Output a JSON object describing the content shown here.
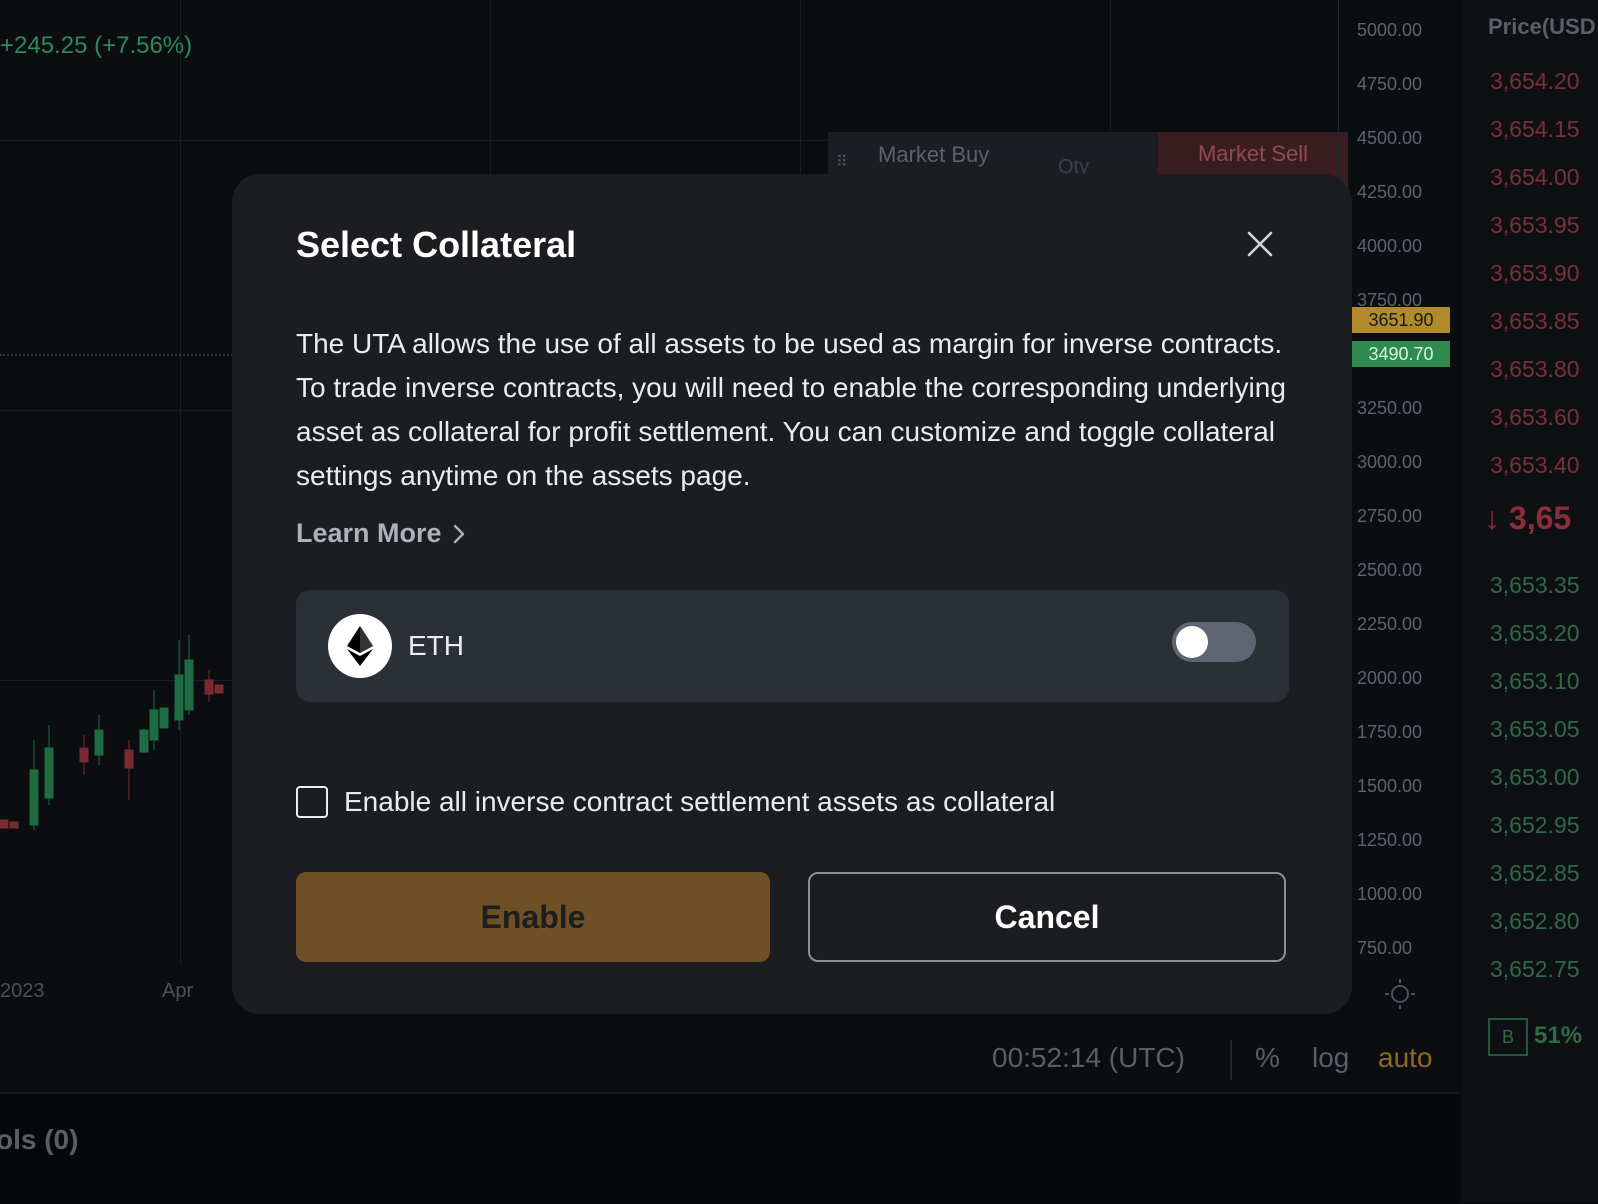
{
  "background": {
    "change_text": "+245.25 (+7.56%)",
    "price_axis": [
      "5000.00",
      "4750.00",
      "4500.00",
      "4250.00",
      "4000.00",
      "3750.00",
      "3250.00",
      "3000.00",
      "2750.00",
      "2500.00",
      "2250.00",
      "2000.00",
      "1750.00",
      "1500.00",
      "1250.00",
      "1000.00",
      "750.00"
    ],
    "current_price_tag": "3651.90",
    "mark_price_tag": "3490.70",
    "quick_trade": {
      "buy_label": "Market Buy",
      "qty_label": "Qty",
      "sell_label": "Market Sell"
    },
    "time_axis": [
      "2023",
      "Apr"
    ],
    "toolbar": {
      "time": "00:52:14 (UTC)",
      "percent": "%",
      "log": "log",
      "auto": "auto"
    },
    "bottom_tab": "ols (0)"
  },
  "orderbook": {
    "header": "Price(USD",
    "asks": [
      "3,654.20",
      "3,654.15",
      "3,654.00",
      "3,653.95",
      "3,653.90",
      "3,653.85",
      "3,653.80",
      "3,653.60",
      "3,653.40"
    ],
    "last_price": "3,65",
    "bids": [
      "3,653.35",
      "3,653.20",
      "3,653.10",
      "3,653.05",
      "3,653.00",
      "3,652.95",
      "3,652.85",
      "3,652.80",
      "3,652.75"
    ],
    "ratio_badge": "B",
    "ratio_value": "51%"
  },
  "modal": {
    "title": "Select Collateral",
    "description": "The UTA allows the use of all assets to be used as margin for inverse contracts. To trade inverse contracts, you will need to enable the corresponding underlying asset as collateral for profit settlement. You can customize and toggle collateral settings anytime on the assets page.",
    "learn_more": "Learn More",
    "asset": {
      "name": "ETH",
      "icon": "eth-icon",
      "enabled": false
    },
    "checkbox_label": "Enable all inverse contract settlement assets as collateral",
    "checkbox_checked": false,
    "enable_button": "Enable",
    "cancel_button": "Cancel"
  },
  "colors": {
    "accent": "#6e5027",
    "modal_bg": "#1b1d21",
    "asset_row_bg": "#2b2f36",
    "ask": "#7a3038",
    "bid": "#2c6b45"
  }
}
